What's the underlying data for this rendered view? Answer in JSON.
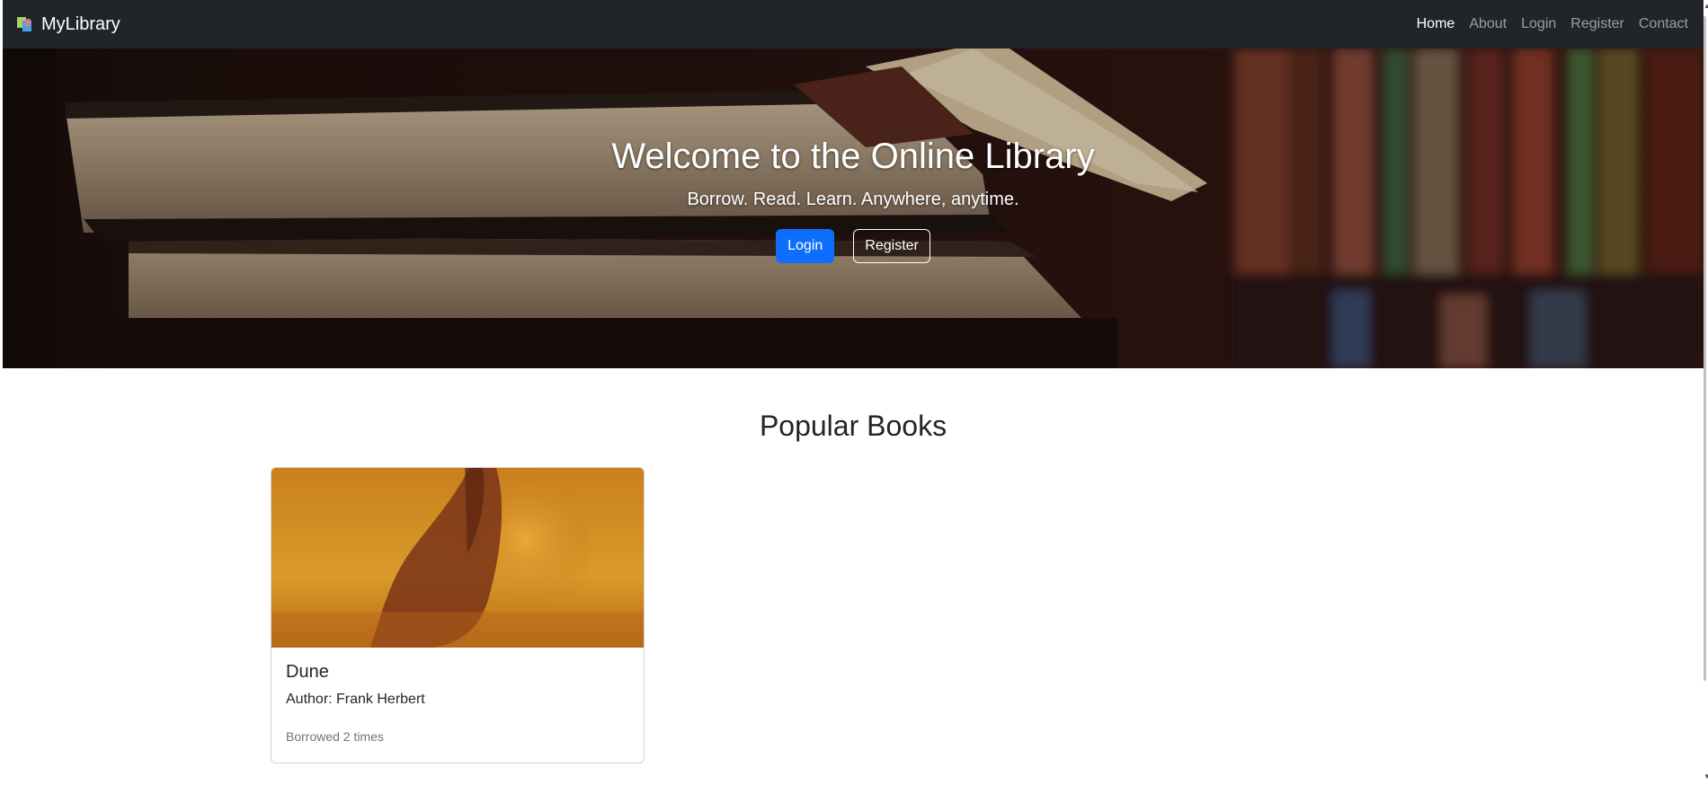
{
  "navbar": {
    "brand": "MyLibrary",
    "brand_icon": "books-icon",
    "links": [
      {
        "label": "Home",
        "active": true
      },
      {
        "label": "About",
        "active": false
      },
      {
        "label": "Login",
        "active": false
      },
      {
        "label": "Register",
        "active": false
      },
      {
        "label": "Contact",
        "active": false
      }
    ]
  },
  "hero": {
    "title": "Welcome to the Online Library",
    "subtitle": "Borrow. Read. Learn. Anywhere, anytime.",
    "login_button": "Login",
    "register_button": "Register"
  },
  "main": {
    "section_title": "Popular Books",
    "books": [
      {
        "title": "Dune",
        "author": "Author: Frank Herbert",
        "borrowed": "Borrowed 2 times"
      }
    ]
  },
  "colors": {
    "navbar_bg": "#212529",
    "primary": "#0d6efd",
    "muted_text": "#6c757d"
  }
}
